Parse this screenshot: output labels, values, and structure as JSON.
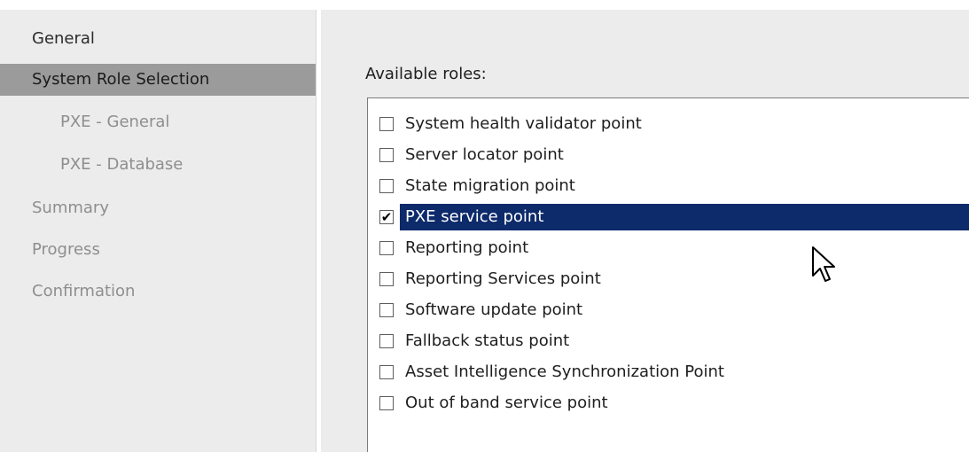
{
  "sidebar": {
    "items": [
      {
        "label": "General"
      },
      {
        "label": "System Role Selection"
      },
      {
        "label": "PXE - General"
      },
      {
        "label": "PXE - Database"
      },
      {
        "label": "Summary"
      },
      {
        "label": "Progress"
      },
      {
        "label": "Confirmation"
      }
    ]
  },
  "main": {
    "roles_label": "Available roles:",
    "roles": [
      {
        "label": "System health validator point",
        "checked": false
      },
      {
        "label": "Server locator point",
        "checked": false
      },
      {
        "label": "State migration point",
        "checked": false
      },
      {
        "label": "PXE service point",
        "checked": true
      },
      {
        "label": "Reporting point",
        "checked": false
      },
      {
        "label": "Reporting Services point",
        "checked": false
      },
      {
        "label": "Software update point",
        "checked": false
      },
      {
        "label": "Fallback status point",
        "checked": false
      },
      {
        "label": "Asset Intelligence Synchronization Point",
        "checked": false
      },
      {
        "label": "Out of band service point",
        "checked": false
      }
    ],
    "check_glyph": "✔"
  },
  "colors": {
    "selection": "#0d2a6b",
    "sidebar_selected": "#9b9b9b",
    "panel": "#ececec"
  }
}
